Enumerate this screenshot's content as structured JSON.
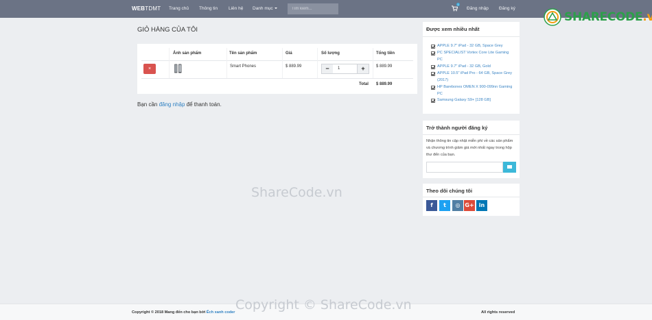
{
  "navbar": {
    "brand_bold": "WEB",
    "brand_rest": "TDMT",
    "links": [
      "Trang chủ",
      "Thông tin",
      "Liên hệ",
      "Danh mục"
    ],
    "search_placeholder": "Tìm kiếm...",
    "cart_count": "1",
    "login": "Đăng nhập",
    "register": "Đăng ký"
  },
  "logo": {
    "text_main": "SHARECODE",
    "text_suffix": ".vn"
  },
  "page": {
    "title": "GIỎ HÀNG CỦA TÔI"
  },
  "cart": {
    "headers": [
      "Ảnh sản phẩm",
      "Tên sản phẩm",
      "Giá",
      "Số lượng",
      "Tổng tiền"
    ],
    "item": {
      "delete_label": "×",
      "name": "Smart Phones",
      "price": "$ 889.99",
      "quantity": "1",
      "minus": "−",
      "plus": "+",
      "subtotal": "$ 889.99"
    },
    "total_label": "Total",
    "total_value": "$ 889.99"
  },
  "login_note": {
    "prefix": "Bạn cần ",
    "link": "đăng nhập",
    "suffix": " để thanh toán."
  },
  "sidebar": {
    "popular": {
      "title": "Được xem nhiều nhất",
      "items": [
        "APPLE 9.7\" iPad - 32 GB, Space Grey",
        "PC SPECIALIST Vortex Core Lite Gaming PC",
        "APPLE 9.7\" iPad - 32 GB, Gold",
        "APPLE 10.5\" iPad Pro - 64 GB, Space Grey (2017)",
        "HP Barebones OMEN X 900-099nn Gaming PC",
        "Samsung Galaxy S9+ [128 GB]"
      ]
    },
    "subscribe": {
      "title": "Trở thành người đăng ký",
      "description": "Nhận thông tin cập nhật miễn phí về các sản phẩm và chương trình giảm giá mới nhất ngay trong hộp thư đến của bạn."
    },
    "follow": {
      "title": "Theo dõi chúng tôi",
      "networks": [
        {
          "label": "f",
          "color": "#3b5998"
        },
        {
          "label": "t",
          "color": "#1da1f2"
        },
        {
          "label": "◎",
          "color": "#517fa4"
        },
        {
          "label": "G+",
          "color": "#dd4b39"
        },
        {
          "label": "in",
          "color": "#0077b5"
        }
      ]
    }
  },
  "watermark": {
    "center": "ShareCode.vn",
    "bottom": "Copyright © ShareCode.vn"
  },
  "footer": {
    "left_prefix": "Copyright © 2018 Mang đến cho bạn bởi ",
    "left_link": "Ếch xanh coder",
    "right": "All rights reserved"
  }
}
